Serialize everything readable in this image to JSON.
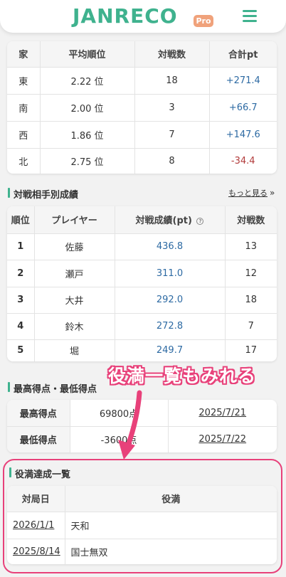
{
  "header": {
    "logo": "JANRECO",
    "badge": "Pro"
  },
  "seat_stats": {
    "columns": [
      "家",
      "平均順位",
      "対戦数",
      "合計pt"
    ],
    "rows": [
      {
        "seat": "東",
        "avg_rank": "2.22 位",
        "games": "18",
        "total_pt": "+271.4"
      },
      {
        "seat": "南",
        "avg_rank": "2.00 位",
        "games": "3",
        "total_pt": "+66.7"
      },
      {
        "seat": "西",
        "avg_rank": "1.86 位",
        "games": "7",
        "total_pt": "+147.6"
      },
      {
        "seat": "北",
        "avg_rank": "2.75 位",
        "games": "8",
        "total_pt": "-34.4"
      }
    ]
  },
  "opponents": {
    "title": "対戦相手別成績",
    "more": "もっと見る",
    "columns": [
      "順位",
      "プレイヤー",
      "対戦成績(pt)",
      "対戦数"
    ],
    "rows": [
      {
        "rank": "1",
        "player": "佐藤",
        "score": "436.8",
        "games": "13"
      },
      {
        "rank": "2",
        "player": "瀬戸",
        "score": "311.0",
        "games": "12"
      },
      {
        "rank": "3",
        "player": "大井",
        "score": "292.0",
        "games": "18"
      },
      {
        "rank": "4",
        "player": "鈴木",
        "score": "272.8",
        "games": "7"
      },
      {
        "rank": "5",
        "player": "堀",
        "score": "249.7",
        "games": "17"
      }
    ]
  },
  "score_records": {
    "title": "最高得点・最低得点",
    "rows": [
      {
        "label": "最高得点",
        "value": "69800点",
        "date": "2025/7/21"
      },
      {
        "label": "最低得点",
        "value": "-3600点",
        "date": "2025/7/22"
      }
    ]
  },
  "yakuman": {
    "title": "役満達成一覧",
    "columns": [
      "対局日",
      "役満"
    ],
    "rows": [
      {
        "date": "2026/1/1",
        "name": "天和"
      },
      {
        "date": "2025/8/14",
        "name": "国士無双"
      }
    ]
  },
  "annotation": {
    "callout": "役満一覧もみれる",
    "color": "#e8417a"
  },
  "colors": {
    "brand": "#3fb28e",
    "positive": "#2d6aa3",
    "negative": "#b23b3b",
    "pro_badge": "#f0a27b"
  }
}
